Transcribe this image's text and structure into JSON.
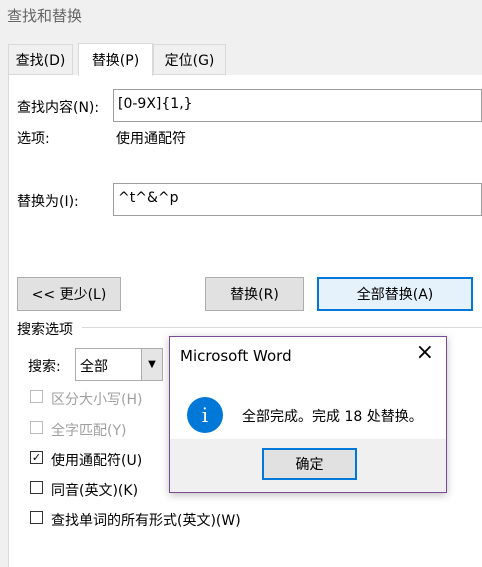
{
  "window": {
    "title": "查找和替换"
  },
  "tabs": [
    {
      "label": "查找(D)"
    },
    {
      "label": "替换(P)"
    },
    {
      "label": "定位(G)"
    }
  ],
  "find": {
    "label": "查找内容(N):",
    "value": "[0-9X]{1,}"
  },
  "options": {
    "label": "选项:",
    "value": "使用通配符"
  },
  "replace": {
    "label": "替换为(I):",
    "value": "^t^&^p"
  },
  "buttons": {
    "less": "<< 更少(L)",
    "replace": "替换(R)",
    "replace_all": "全部替换(A)"
  },
  "search_options": {
    "header": "搜索选项",
    "search_label": "搜索:",
    "search_value": "全部",
    "checkboxes": [
      {
        "label": "区分大小写(H)",
        "checked": false,
        "disabled": true
      },
      {
        "label": "全字匹配(Y)",
        "checked": false,
        "disabled": true
      },
      {
        "label": "使用通配符(U)",
        "checked": true,
        "disabled": false
      },
      {
        "label": "同音(英文)(K)",
        "checked": false,
        "disabled": false
      },
      {
        "label": "查找单词的所有形式(英文)(W)",
        "checked": false,
        "disabled": false
      }
    ]
  },
  "dialog": {
    "title": "Microsoft Word",
    "message": "全部完成。完成 18 处替换。",
    "ok": "确定",
    "close": "×",
    "icon": "info-icon",
    "icon_glyph": "i",
    "accent": "#0078d7"
  }
}
